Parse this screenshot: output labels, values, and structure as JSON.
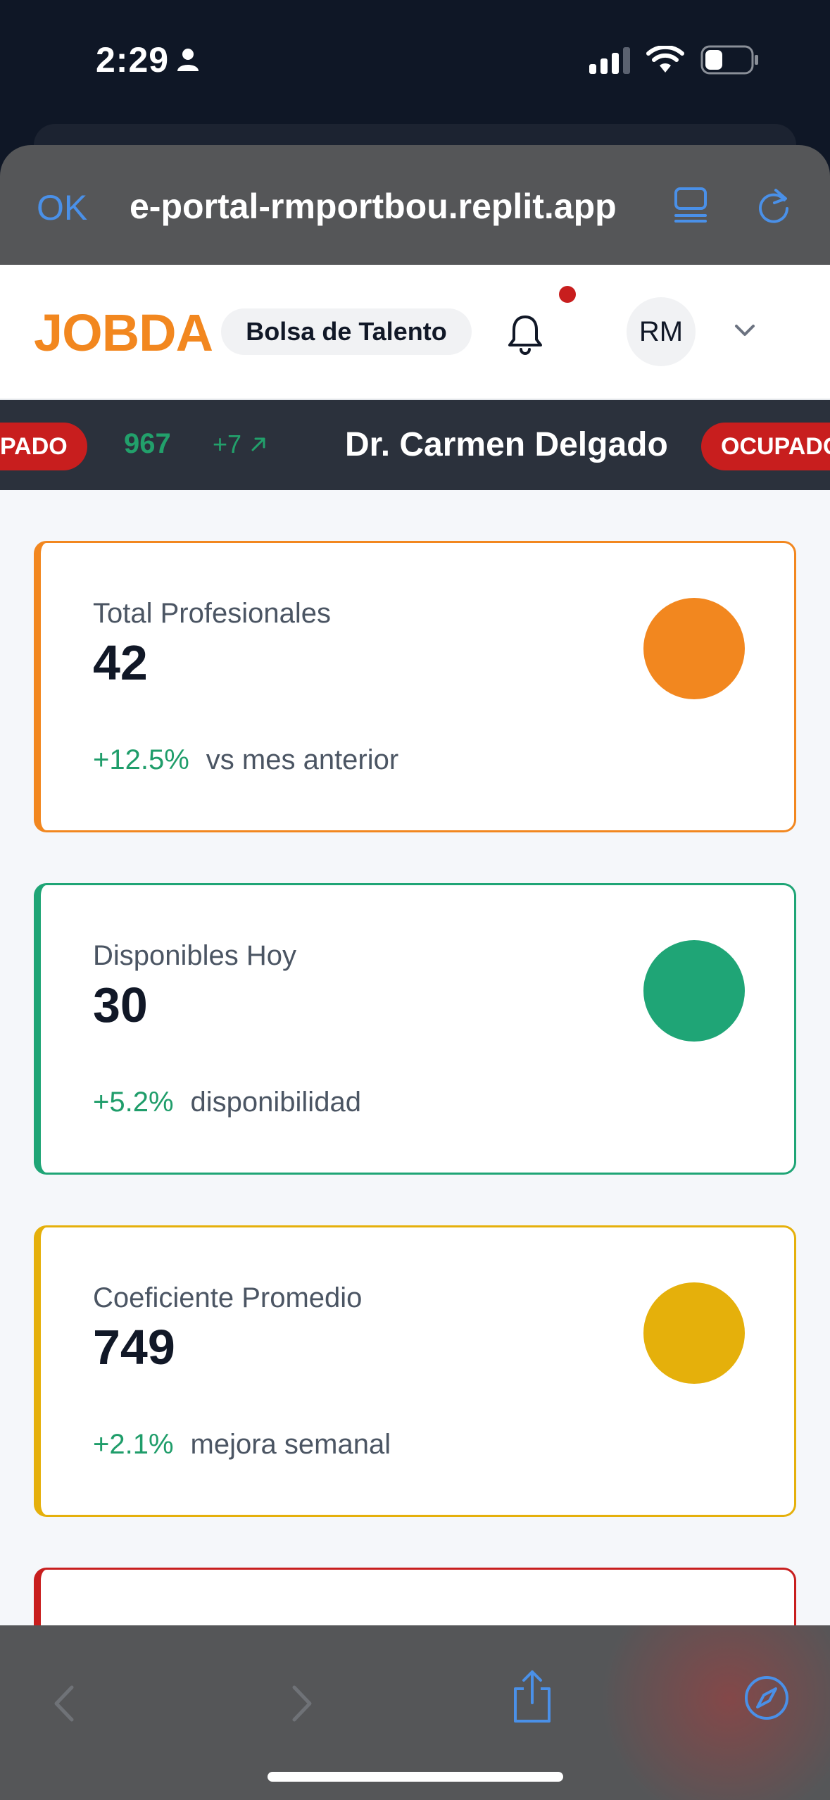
{
  "status_bar": {
    "time": "2:29",
    "icons": [
      "person-icon",
      "signal-icon",
      "wifi-icon",
      "battery-icon"
    ]
  },
  "browser": {
    "done_label": "OK",
    "url": "e-portal-rmportbou.replit.app",
    "icons": [
      "reader-icon",
      "reload-icon"
    ],
    "toolbar_icons": [
      "back-icon",
      "forward-icon",
      "share-icon",
      "compass-icon"
    ]
  },
  "header": {
    "brand": "JOBDA",
    "tag": "Bolsa de Talento",
    "avatar_initials": "RM",
    "icons": [
      "bell-icon",
      "chevron-down-icon"
    ]
  },
  "ticker": {
    "left_badge": "PADO",
    "score": "967",
    "change": "+7",
    "name": "Dr. Carmen Delgado",
    "right_badge": "OCUPADO"
  },
  "stats": [
    {
      "label": "Total Profesionales",
      "value": "42",
      "delta": "+12.5%",
      "desc": "vs mes anterior",
      "color": "#f2871f"
    },
    {
      "label": "Disponibles Hoy",
      "value": "30",
      "delta": "+5.2%",
      "desc": "disponibilidad",
      "color": "#1fa576"
    },
    {
      "label": "Coeficiente Promedio",
      "value": "749",
      "delta": "+2.1%",
      "desc": "mejora semanal",
      "color": "#e5b00b"
    },
    {
      "color": "#c81e1e"
    }
  ],
  "colors": {
    "accent": "#f2871f",
    "link": "#4a90e8",
    "positive": "#1f9d6a",
    "alert": "#c81e1e"
  }
}
